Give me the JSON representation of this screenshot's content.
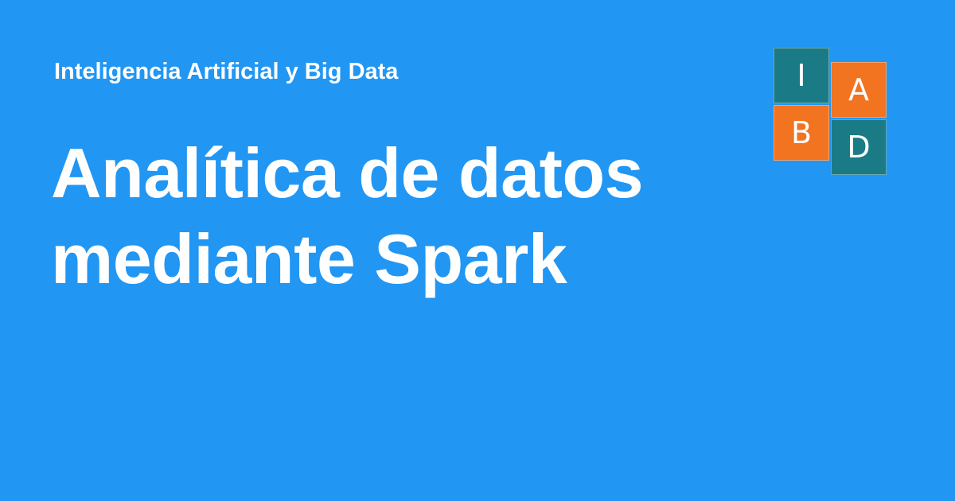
{
  "header": {
    "site_name": "Inteligencia Artificial y Big Data"
  },
  "main": {
    "title": "Analítica de datos mediante Spark"
  },
  "logo": {
    "tiles": [
      {
        "letter": "I",
        "color": "#1a7b86"
      },
      {
        "letter": "A",
        "color": "#f27320"
      },
      {
        "letter": "B",
        "color": "#f27320"
      },
      {
        "letter": "D",
        "color": "#1a7b86"
      }
    ]
  },
  "colors": {
    "background": "#2196f3",
    "text": "#ffffff",
    "teal": "#1a7b86",
    "orange": "#f27320"
  }
}
